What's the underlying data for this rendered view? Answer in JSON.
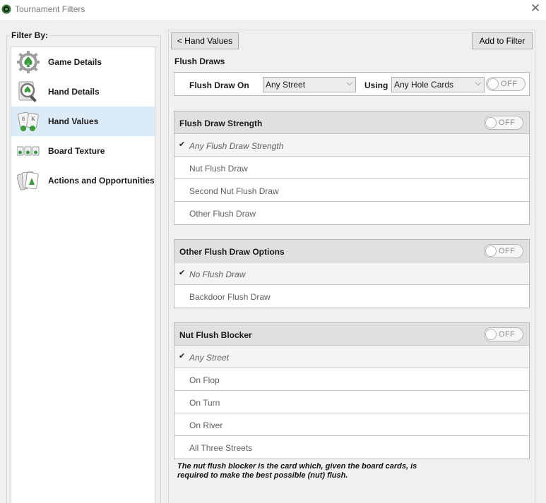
{
  "window": {
    "title": "Tournament Filters",
    "close_icon": "close-icon"
  },
  "filter_by": {
    "title": "Filter By:",
    "items": [
      {
        "label": "Game Details",
        "icon": "gear-spade-icon",
        "active": false
      },
      {
        "label": "Hand Details",
        "icon": "magnifier-spade-icon",
        "active": false
      },
      {
        "label": "Hand Values",
        "icon": "cards-icon",
        "active": true
      },
      {
        "label": "Board Texture",
        "icon": "board-cards-icon",
        "active": false
      },
      {
        "label": "Actions and Opportunities",
        "icon": "card-stack-icon",
        "active": false
      }
    ]
  },
  "toolbar": {
    "back_label": "< Hand Values",
    "add_label": "Add to Filter"
  },
  "flush_draws": {
    "title": "Flush Draws",
    "on_label": "Flush Draw On",
    "street_value": "Any Street",
    "using_label": "Using",
    "hole_value": "Any Hole Cards",
    "toggle": "OFF"
  },
  "panels": [
    {
      "title": "Flush Draw Strength",
      "toggle": "OFF",
      "options": [
        {
          "label": "Any Flush Draw Strength",
          "selected": true
        },
        {
          "label": "Nut Flush Draw",
          "selected": false
        },
        {
          "label": "Second Nut Flush Draw",
          "selected": false
        },
        {
          "label": "Other Flush Draw",
          "selected": false
        }
      ]
    },
    {
      "title": "Other Flush Draw Options",
      "toggle": "OFF",
      "options": [
        {
          "label": "No Flush Draw",
          "selected": true
        },
        {
          "label": "Backdoor Flush Draw",
          "selected": false
        }
      ]
    },
    {
      "title": "Nut Flush Blocker",
      "toggle": "OFF",
      "options": [
        {
          "label": "Any Street",
          "selected": true
        },
        {
          "label": "On Flop",
          "selected": false
        },
        {
          "label": "On Turn",
          "selected": false
        },
        {
          "label": "On River",
          "selected": false
        },
        {
          "label": "All Three Streets",
          "selected": false
        }
      ]
    }
  ],
  "note": "The nut flush blocker is the card which, given the board cards, is required to make the best possible (nut) flush.",
  "colors": {
    "active_item": "#dbebf7",
    "panel_header": "#e0e0e0",
    "icon_green": "#3a9b3a"
  }
}
